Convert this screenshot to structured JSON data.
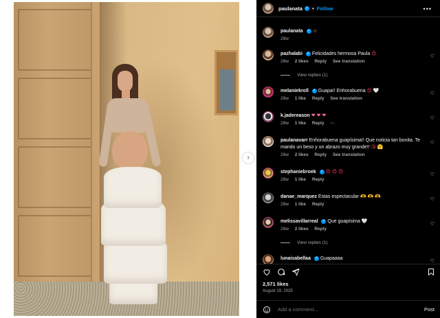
{
  "post": {
    "author": "paulanata",
    "follow_label": "Follow",
    "caption_emoji": "☺",
    "caption_time": "28w",
    "likes": "2,571 likes",
    "date": "August 19, 2025",
    "add_comment_placeholder": "Add a comment...",
    "post_label": "Post"
  },
  "comments": [
    {
      "user": "pazhalabi",
      "text": "Felicidades hermosa Paula",
      "emoji": "😍",
      "time": "28w",
      "likes": "2 likes",
      "reply": "Reply",
      "translate": "See translation",
      "verified": true,
      "replies": "View replies (1)"
    },
    {
      "user": "melaniekroll",
      "text": "Guapa!! Enhorabuena",
      "emoji": "😍 🤍",
      "time": "28w",
      "likes": "1 like",
      "reply": "Reply",
      "translate": "See translation",
      "verified": true
    },
    {
      "user": "k.jadereason",
      "text": "",
      "emoji": "❤ ❤ ❤",
      "time": "28w",
      "likes": "1 like",
      "reply": "Reply",
      "more": "···",
      "verified": false
    },
    {
      "user": "paulanavarr",
      "text": "Enhorabuena guapísima!! Que noticia tan bonita. Te mando un beso y un abrazo muy grande!!",
      "emoji": "😘 🤗",
      "time": "28w",
      "likes": "2 likes",
      "reply": "Reply",
      "translate": "See translation",
      "verified": false
    },
    {
      "user": "stephaniebroek",
      "text": "",
      "emoji": "😍 😍 😍",
      "time": "28w",
      "likes": "1 like",
      "reply": "Reply",
      "verified": true
    },
    {
      "user": "danae_marquez",
      "text": "Estas espectacular",
      "emoji": "🫶 🫶 🫶",
      "time": "28w",
      "likes": "1 like",
      "reply": "Reply",
      "verified": false
    },
    {
      "user": "melissavillarreal",
      "text": "Que guapísima",
      "emoji": "🤍",
      "time": "28w",
      "likes": "2 likes",
      "reply": "Reply",
      "verified": true,
      "replies": "View replies (1)"
    },
    {
      "user": "lunaisabellaa",
      "text": "Guapaaaa",
      "emoji": "",
      "verified": true
    }
  ],
  "colors": {
    "accent": "#0095f6",
    "background": "#000000",
    "muted_text": "#a8a8a8"
  }
}
